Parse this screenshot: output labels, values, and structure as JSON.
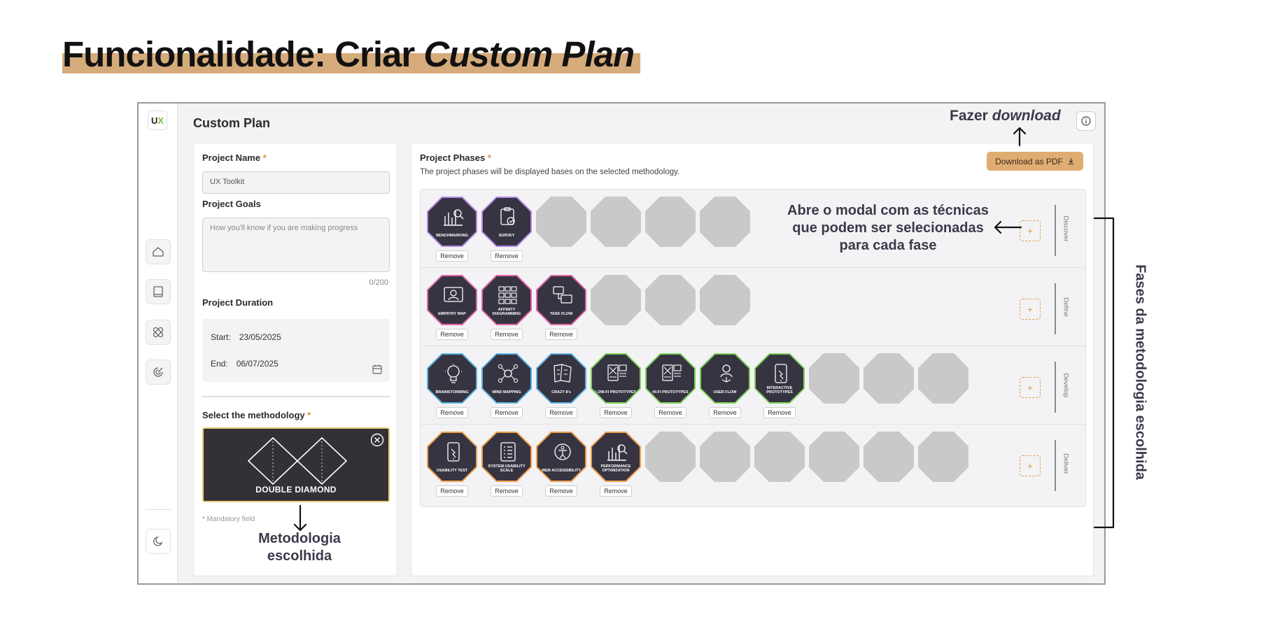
{
  "slide": {
    "title_plain": "Funcionalidade: Criar ",
    "title_italic": "Custom Plan",
    "highlight_color": "#d6ab7b"
  },
  "app": {
    "logo_text_dark": "U",
    "logo_text_accent": "X",
    "title": "Custom Plan",
    "sidebar_icons": [
      "home-icon",
      "book-icon",
      "bandage-icon",
      "target-icon",
      "moon-icon"
    ],
    "info_icon": "info-icon"
  },
  "form": {
    "project_name_label": "Project Name",
    "required_mark": "*",
    "project_name_value": "UX Toolkit",
    "project_goals_label": "Project Goals",
    "project_goals_placeholder": "How you'll know if you are making progress",
    "goals_counter": "0/200",
    "duration_label": "Project Duration",
    "start_label": "Start:",
    "start_value": "23/05/2025",
    "end_label": "End:",
    "end_value": "06/07/2025",
    "methodology_label": "Select the methodology",
    "methodology_selected": "DOUBLE DIAMOND",
    "mandatory_note": "* Mandatory field"
  },
  "phases_panel": {
    "title": "Project Phases",
    "subtitle": "The project phases will be displayed bases on the selected methodology.",
    "download_label": "Download as PDF",
    "remove_label": "Remove",
    "add_label": "+",
    "accent_color": "#dfac72",
    "phases": [
      {
        "name": "Discover",
        "techniques": [
          {
            "label": "BENCHMARKING",
            "border": "#b48ae6",
            "icon": "chart-icon"
          },
          {
            "label": "SURVEY",
            "border": "#b48ae6",
            "icon": "clipboard-icon"
          }
        ],
        "empty_slots": 4
      },
      {
        "name": "Define",
        "techniques": [
          {
            "label": "EMPATHY MAP",
            "border": "#e466a8",
            "icon": "person-icon"
          },
          {
            "label": "AFFINITY DIAGRAMMING",
            "border": "#e466a8",
            "icon": "grid-icon"
          },
          {
            "label": "TASK FLOW",
            "border": "#e466a8",
            "icon": "flow-icon"
          }
        ],
        "empty_slots": 3
      },
      {
        "name": "Develop",
        "techniques": [
          {
            "label": "BRAINSTORMING",
            "border": "#5ab4e0",
            "icon": "bulb-icon"
          },
          {
            "label": "MIND MAPPING",
            "border": "#5ab4e0",
            "icon": "mindmap-icon"
          },
          {
            "label": "CRAZY 8's",
            "border": "#5ab4e0",
            "icon": "paper-icon"
          },
          {
            "label": "LOW-FI PROTOTYPES",
            "border": "#7fd35a",
            "icon": "wireframe-icon"
          },
          {
            "label": "HI-FI PROTOTYPES",
            "border": "#7fd35a",
            "icon": "wireframe-icon"
          },
          {
            "label": "USER FLOW",
            "border": "#7fd35a",
            "icon": "userflow-icon"
          },
          {
            "label": "INTERACTIVE PROTOTYPES",
            "border": "#7fd35a",
            "icon": "phone-icon"
          }
        ],
        "empty_slots": 3
      },
      {
        "name": "Deliver",
        "techniques": [
          {
            "label": "USABILITY TEST",
            "border": "#f0a04a",
            "icon": "phone-icon"
          },
          {
            "label": "SYSTEM USABILITY SCALE",
            "border": "#f0a04a",
            "icon": "list-icon"
          },
          {
            "label": "WEB ACCESSIBILITY",
            "border": "#f0a04a",
            "icon": "accessibility-icon"
          },
          {
            "label": "PERFORMANCE OPTIMIZATION",
            "border": "#f0a04a",
            "icon": "chart-icon"
          }
        ],
        "empty_slots": 6
      }
    ]
  },
  "annotations": {
    "download_plain": "Fazer ",
    "download_italic": "download",
    "modal": "Abre o modal com as técnicas que podem ser selecionadas para cada fase",
    "methodology": "Metodologia escolhida",
    "phases": "Fases da metodologia escolhida"
  }
}
